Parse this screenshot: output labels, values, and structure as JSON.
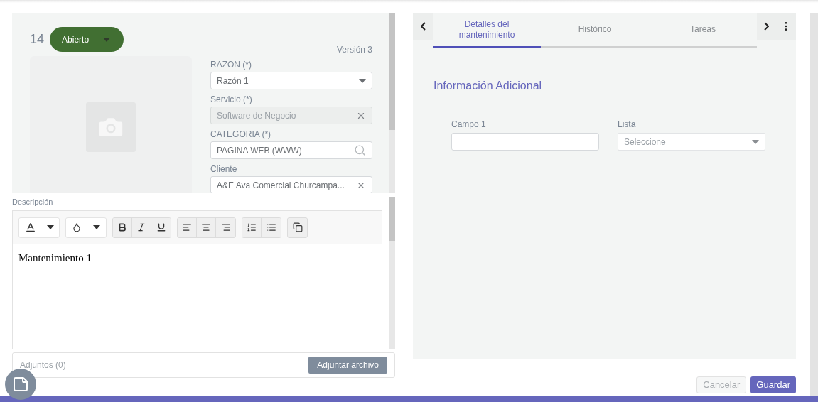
{
  "record": {
    "number": "14",
    "status": {
      "label": "Abierto",
      "color": "#416f32"
    },
    "version": "Versión 3",
    "fields": [
      {
        "kind": "select",
        "label": "RAZON (*)",
        "value": "Razón 1",
        "disabled": false
      },
      {
        "kind": "clear",
        "label": "Servicio (*)",
        "value": "Software de Negocio",
        "disabled": true
      },
      {
        "kind": "search",
        "label": "CATEGORIA (*)",
        "value": "PAGINA WEB (WWW)",
        "disabled": false
      },
      {
        "kind": "clear",
        "label": "Cliente",
        "value": "A&E Ava Comercial Churcampa...",
        "disabled": false
      }
    ]
  },
  "description": {
    "label": "Descripción",
    "content": "Mantenimiento 1"
  },
  "attachments": {
    "label": "Adjuntos (0)",
    "button": "Adjuntar archivo"
  },
  "tabs": [
    {
      "label": "Detalles del mantenimiento",
      "selected": true
    },
    {
      "label": "Histórico",
      "selected": false
    },
    {
      "label": "Tareas",
      "selected": false
    }
  ],
  "section_title": "Información Adicional",
  "extra_fields": [
    {
      "kind": "text",
      "label": "Campo 1"
    },
    {
      "kind": "select",
      "label": "Lista",
      "placeholder": "Seleccione"
    }
  ],
  "buttons": [
    {
      "label": "Cancelar",
      "kind": "secondary",
      "disabled": true
    },
    {
      "label": "Guardar",
      "kind": "primary",
      "disabled": false
    }
  ]
}
